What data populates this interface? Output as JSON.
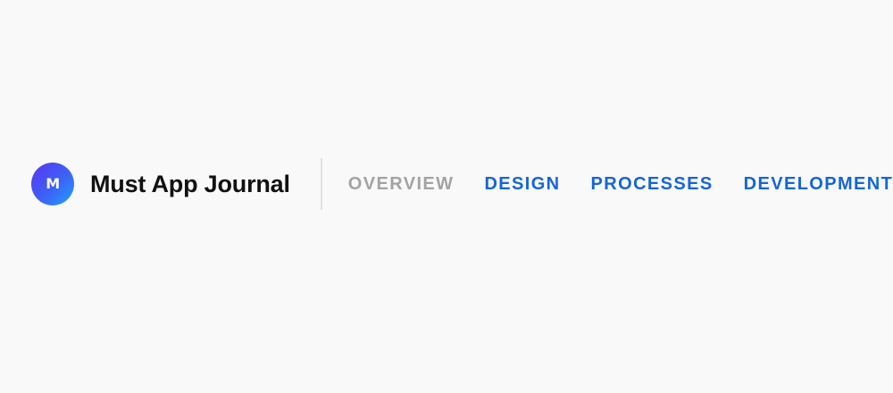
{
  "brand": {
    "logo_letter": "M",
    "title": "Must App Journal"
  },
  "nav": {
    "items": [
      {
        "label": "OVERVIEW",
        "active": true
      },
      {
        "label": "DESIGN",
        "active": false
      },
      {
        "label": "PROCESSES",
        "active": false
      },
      {
        "label": "DEVELOPMENT",
        "active": false
      }
    ]
  },
  "colors": {
    "background": "#f9f9f9",
    "title_text": "#111111",
    "nav_link": "#1565d8",
    "nav_active": "#a3a3a3",
    "divider": "#e2e2e2",
    "logo_gradient": [
      "#5b35f0",
      "#3b62f7",
      "#1fa2ff"
    ]
  }
}
